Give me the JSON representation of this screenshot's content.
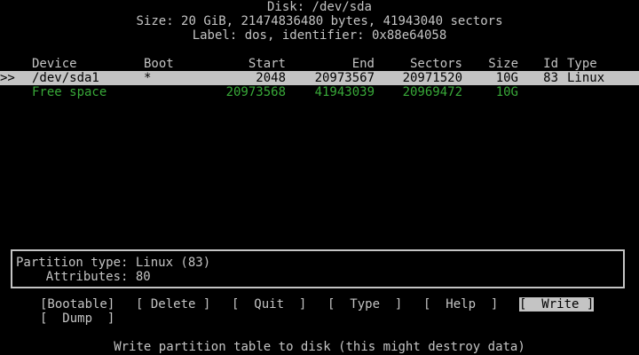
{
  "header": {
    "title": "Disk: /dev/sda",
    "size": "Size: 20 GiB, 21474836480 bytes, 41943040 sectors",
    "label": "Label: dos, identifier: 0x88e64058"
  },
  "table": {
    "columns": {
      "device": "Device",
      "boot": "Boot",
      "start": "Start",
      "end": "End",
      "sectors": "Sectors",
      "size": "Size",
      "id": "Id",
      "type": "Type"
    },
    "rows": [
      {
        "cursor": ">>",
        "device": "/dev/sda1",
        "boot": "*",
        "start": "2048",
        "end": "20973567",
        "sectors": "20971520",
        "size": "10G",
        "id": "83",
        "type": "Linux",
        "selected": true
      },
      {
        "cursor": "",
        "device": "Free space",
        "boot": "",
        "start": "20973568",
        "end": "41943039",
        "sectors": "20969472",
        "size": "10G",
        "id": "",
        "type": "",
        "selected": false
      }
    ]
  },
  "info": {
    "partition_type": "Partition type: Linux (83)",
    "attributes": "    Attributes: 80"
  },
  "menu": {
    "bootable": "[Bootable]",
    "delete": "[ Delete ]",
    "quit": "[  Quit  ]",
    "type": "[  Type  ]",
    "help": "[  Help  ]",
    "write": "[  Write ]",
    "dump": "[  Dump  ]"
  },
  "status": "Write partition table to disk (this might destroy data)",
  "colors": {
    "background": "#000000",
    "foreground": "#c4c4c4",
    "free_space": "#38a838"
  }
}
